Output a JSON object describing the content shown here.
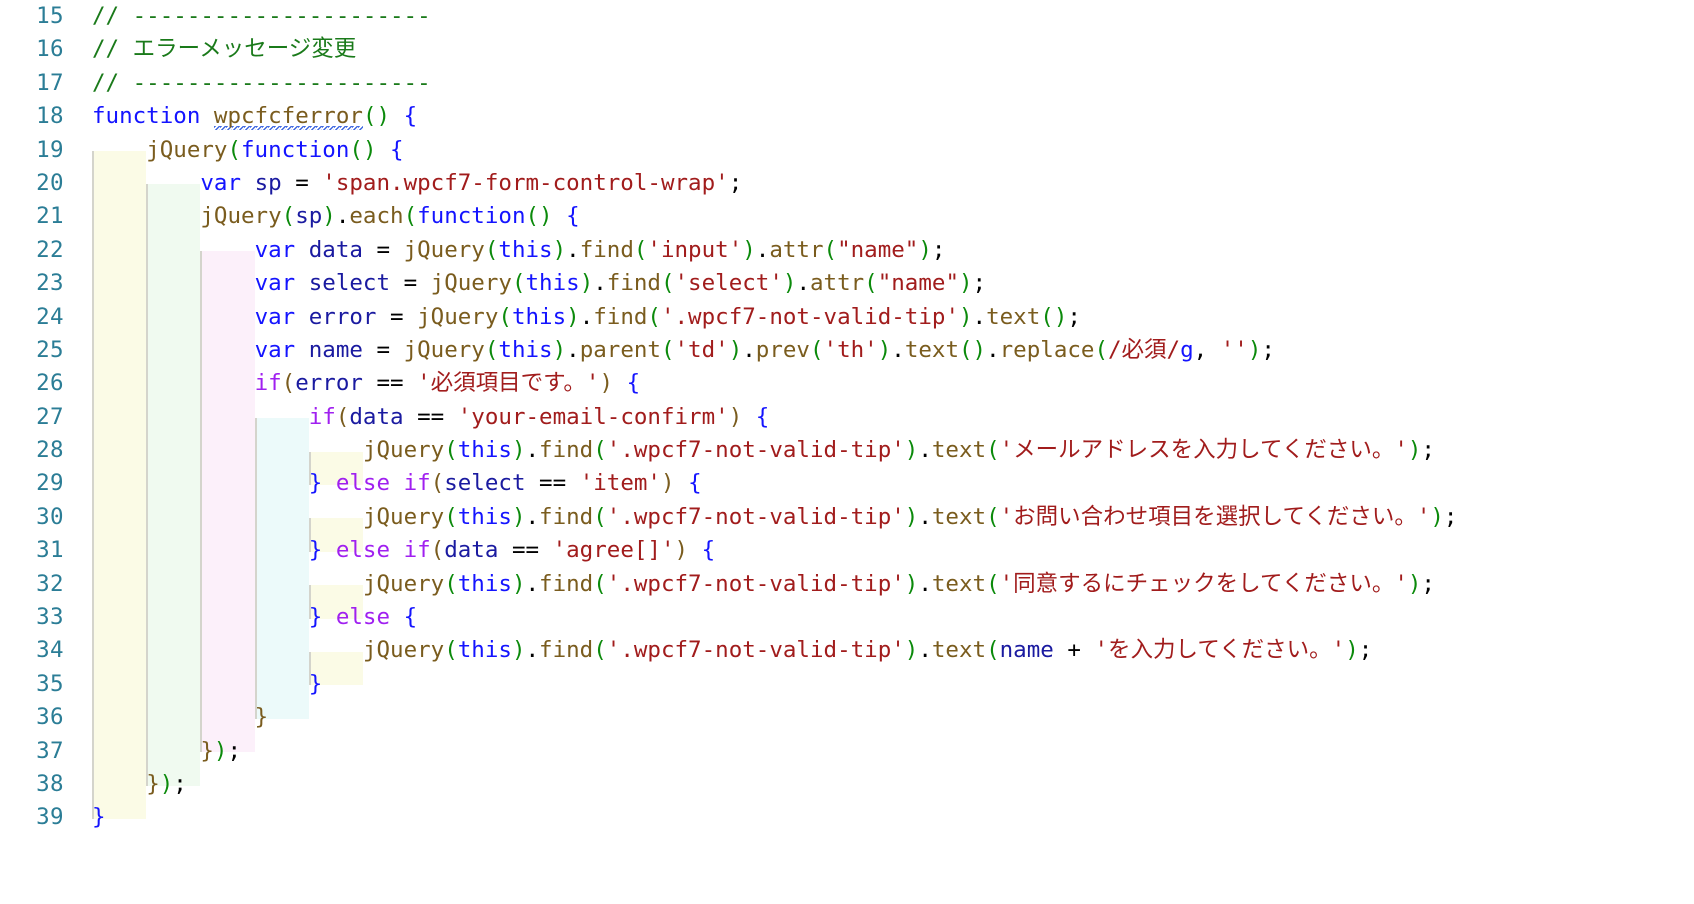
{
  "editor": {
    "language": "javascript",
    "first_line_number": 15,
    "last_line_number": 39,
    "background_color": "#ffffff",
    "gutter_color": "#2b7d96",
    "indent_guide_colors": [
      "#fbfbe6",
      "#f0faf0",
      "#fcf0fa",
      "#ecfafa",
      "#fbfbe6"
    ],
    "indent_guide_border": "#d4d4cc"
  },
  "colors": {
    "comment": "#1a7a1a",
    "keyword": "#1414ff",
    "control": "#a020f0",
    "function": "#7a5c1e",
    "string": "#a11c1c",
    "variable": "#1a1aa0",
    "paren_green": "#0b8a0b",
    "brace_blue": "#1414ff",
    "brace_brown": "#7a5c1e",
    "plain": "#000000"
  },
  "line_numbers": [
    "15",
    "16",
    "17",
    "18",
    "19",
    "20",
    "21",
    "22",
    "23",
    "24",
    "25",
    "26",
    "27",
    "28",
    "29",
    "30",
    "31",
    "32",
    "33",
    "34",
    "35",
    "36",
    "37",
    "38",
    "39"
  ],
  "code_lines": [
    {
      "n": "15",
      "text": "// ----------------------"
    },
    {
      "n": "16",
      "text": "// エラーメッセージ変更"
    },
    {
      "n": "17",
      "text": "// ----------------------"
    },
    {
      "n": "18",
      "text": "function wpcfcferror() {"
    },
    {
      "n": "19",
      "text": "    jQuery(function() {"
    },
    {
      "n": "20",
      "text": "        var sp = 'span.wpcf7-form-control-wrap';"
    },
    {
      "n": "21",
      "text": "        jQuery(sp).each(function() {"
    },
    {
      "n": "22",
      "text": "            var data = jQuery(this).find('input').attr(\"name\");"
    },
    {
      "n": "23",
      "text": "            var select = jQuery(this).find('select').attr(\"name\");"
    },
    {
      "n": "24",
      "text": "            var error = jQuery(this).find('.wpcf7-not-valid-tip').text();"
    },
    {
      "n": "25",
      "text": "            var name = jQuery(this).parent('td').prev('th').text().replace(/必須/g, '');"
    },
    {
      "n": "26",
      "text": "            if(error == '必須項目です。') {"
    },
    {
      "n": "27",
      "text": "                if(data == 'your-email-confirm') {"
    },
    {
      "n": "28",
      "text": "                    jQuery(this).find('.wpcf7-not-valid-tip').text('メールアドレスを入力してください。');"
    },
    {
      "n": "29",
      "text": "                } else if(select == 'item') {"
    },
    {
      "n": "30",
      "text": "                    jQuery(this).find('.wpcf7-not-valid-tip').text('お問い合わせ項目を選択してください。');"
    },
    {
      "n": "31",
      "text": "                } else if(data == 'agree[]') {"
    },
    {
      "n": "32",
      "text": "                    jQuery(this).find('.wpcf7-not-valid-tip').text('同意するにチェックをしてください。');"
    },
    {
      "n": "33",
      "text": "                } else {"
    },
    {
      "n": "34",
      "text": "                    jQuery(this).find('.wpcf7-not-valid-tip').text(name + 'を入力してください。');"
    },
    {
      "n": "35",
      "text": "                }"
    },
    {
      "n": "36",
      "text": "            }"
    },
    {
      "n": "37",
      "text": "        });"
    },
    {
      "n": "38",
      "text": "    });"
    },
    {
      "n": "39",
      "text": "}"
    }
  ],
  "strings": {
    "s_span_wrap": "'span.wpcf7-form-control-wrap'",
    "s_input": "'input'",
    "s_name_dq": "\"name\"",
    "s_select": "'select'",
    "s_tip": "'.wpcf7-not-valid-tip'",
    "s_td": "'td'",
    "s_th": "'th'",
    "s_empty": "''",
    "s_required": "'必須項目です。'",
    "s_email_confirm": "'your-email-confirm'",
    "s_item": "'item'",
    "s_agree": "'agree[]'",
    "msg_email": "'メールアドレスを入力してください。'",
    "msg_item": "'お問い合わせ項目を選択してください。'",
    "msg_agree": "'同意するにチェックをしてください。'",
    "msg_generic": "'を入力してください。'",
    "regex_required": "/必須/",
    "regex_flag": "g"
  },
  "comments": {
    "divider_top": "// ----------------------",
    "title": "// エラーメッセージ変更",
    "divider_bottom": "// ----------------------"
  },
  "identifiers": {
    "function_name": "wpcfcferror",
    "var_sp": "sp",
    "var_data": "data",
    "var_select": "select",
    "var_error": "error",
    "var_name": "name",
    "jquery": "jQuery",
    "find": "find",
    "attr": "attr",
    "text": "text",
    "each": "each",
    "parent": "parent",
    "prev": "prev",
    "replace": "replace"
  },
  "keywords": {
    "kw_function": "function",
    "kw_var": "var",
    "kw_this": "this",
    "kw_if": "if",
    "kw_else": "else"
  }
}
